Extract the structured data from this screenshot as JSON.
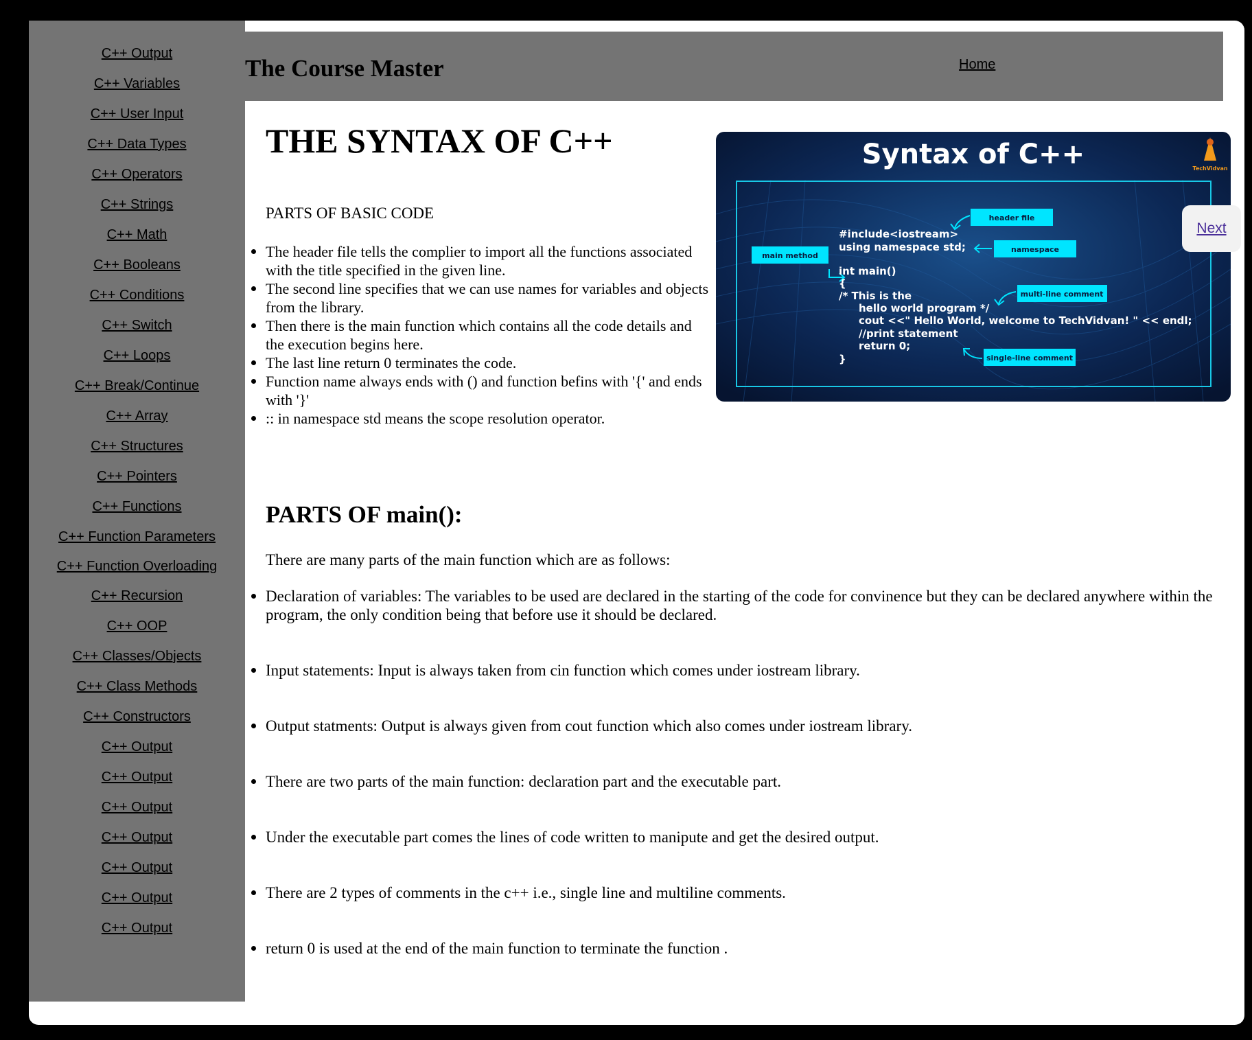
{
  "sidebar": {
    "items": [
      {
        "label": "C++ Output"
      },
      {
        "label": "C++ Variables"
      },
      {
        "label": "C++ User Input"
      },
      {
        "label": "C++ Data Types"
      },
      {
        "label": "C++ Operators"
      },
      {
        "label": "C++ Strings"
      },
      {
        "label": "C++ Math"
      },
      {
        "label": "C++ Booleans"
      },
      {
        "label": "C++ Conditions"
      },
      {
        "label": "C++ Switch"
      },
      {
        "label": "C++ Loops"
      },
      {
        "label": "C++ Break/Continue"
      },
      {
        "label": "C++ Array"
      },
      {
        "label": "C++ Structures"
      },
      {
        "label": "C++ Pointers"
      },
      {
        "label": "C++ Functions"
      },
      {
        "label": "C++ Function Parameters"
      },
      {
        "label": "C++ Function Overloading"
      },
      {
        "label": "C++ Recursion"
      },
      {
        "label": "C++ OOP"
      },
      {
        "label": "C++ Classes/Objects"
      },
      {
        "label": "C++ Class Methods"
      },
      {
        "label": "C++ Constructors"
      },
      {
        "label": "C++ Output"
      },
      {
        "label": "C++ Output"
      },
      {
        "label": "C++ Output"
      },
      {
        "label": "C++ Output"
      },
      {
        "label": "C++ Output"
      },
      {
        "label": "C++ Output"
      },
      {
        "label": "C++ Output"
      }
    ]
  },
  "header": {
    "brand": "The Course Master",
    "home_label": "Home"
  },
  "next_label": "Next",
  "main": {
    "title": "THE SYNTAX OF C++",
    "parts_heading": "PARTS OF BASIC CODE",
    "basic_points": [
      "The header file tells the complier to import all the functions associated with the title specified in the given line.",
      "The second line specifies that we can use names for variables and objects from the library.",
      "Then there is the main function which contains all the code details and the execution begins here.",
      "The last line return 0 terminates the code.",
      "Function name always ends with () and function befins with '{' and ends with '}'",
      ":: in namespace std means the scope resolution operator."
    ],
    "main_heading": "PARTS OF main():",
    "main_intro": "There are many parts of the main function which are as follows:",
    "main_points": [
      "Declaration of variables: The variables to be used are declared in the starting of the code for convinence but they can be declared anywhere within the program, the only condition being that before use it should be declared.",
      "Input statements: Input is always taken from cin function which comes under iostream library.",
      "Output statments: Output is always given from cout function which also comes under iostream library.",
      "There are two parts of the main function: declaration part and the executable part.",
      "Under the executable part comes the lines of code written to manipute and get the desired output.",
      "There are 2 types of comments in the c++ i.e., single line and multiline comments.",
      "return 0 is used at the end of the main function to terminate the function ."
    ]
  },
  "image": {
    "title": "Syntax of C++",
    "brand": "TechVidvan",
    "code": [
      "#include<iostream>",
      "using namespace std;",
      "int main()",
      "{",
      "/*  This is the",
      "hello world program */",
      "cout <<\" Hello World,  welcome to TechVidvan! \" << endl;",
      "//print statement",
      "return 0;",
      "}"
    ],
    "tags": {
      "header_file": "header file",
      "namespace": "namespace",
      "main_method": "main method",
      "multi_line": "multi-line comment",
      "single_line": "single-line comment"
    }
  },
  "colors": {
    "sidebar_bg": "#747474",
    "tag_cyan": "#00e5ff",
    "image_bg": "#0a1c3d"
  }
}
